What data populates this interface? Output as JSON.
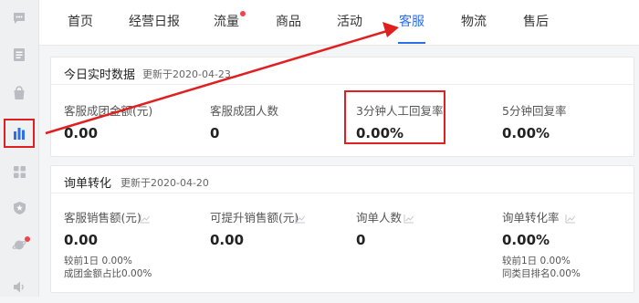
{
  "sidebar": {
    "items": [
      {
        "icon": "chat-icon"
      },
      {
        "icon": "document-icon"
      },
      {
        "icon": "shopping-bag-icon"
      },
      {
        "icon": "bar-chart-icon",
        "active": true
      },
      {
        "icon": "apps-grid-icon"
      },
      {
        "icon": "shield-star-icon"
      },
      {
        "icon": "planet-icon",
        "badge": true
      },
      {
        "icon": "speaker-icon"
      }
    ]
  },
  "nav": {
    "tabs": [
      {
        "label": "首页"
      },
      {
        "label": "经营日报"
      },
      {
        "label": "流量",
        "badge": true
      },
      {
        "label": "商品"
      },
      {
        "label": "活动"
      },
      {
        "label": "客服",
        "active": true
      },
      {
        "label": "物流"
      },
      {
        "label": "售后"
      }
    ]
  },
  "realtime": {
    "title": "今日实时数据",
    "updated": "更新于2020-04-23",
    "metrics": [
      {
        "label": "客服成团金额(元)",
        "value": "0.00"
      },
      {
        "label": "客服成团人数",
        "value": "0"
      },
      {
        "label": "3分钟人工回复率",
        "value": "0.00%"
      },
      {
        "label": "5分钟回复率",
        "value": "0.00%"
      }
    ]
  },
  "inquiry": {
    "title": "询单转化",
    "updated": "更新于2020-04-20",
    "metrics": [
      {
        "label": "客服销售额(元)",
        "value": "0.00",
        "sub1": "较前1日 0.00%",
        "sub2": "成团金额占比0.00%"
      },
      {
        "label": "可提升销售额(元)",
        "value": "0.00"
      },
      {
        "label": "询单人数",
        "value": "0"
      },
      {
        "label": "询单转化率",
        "value": "0.00%",
        "sub1": "较前1日 0.00%",
        "sub2": "同类目排名0.00%"
      }
    ]
  },
  "colors": {
    "accent": "#2d6eea",
    "annotation": "#e02020",
    "badge": "#f2434b"
  }
}
